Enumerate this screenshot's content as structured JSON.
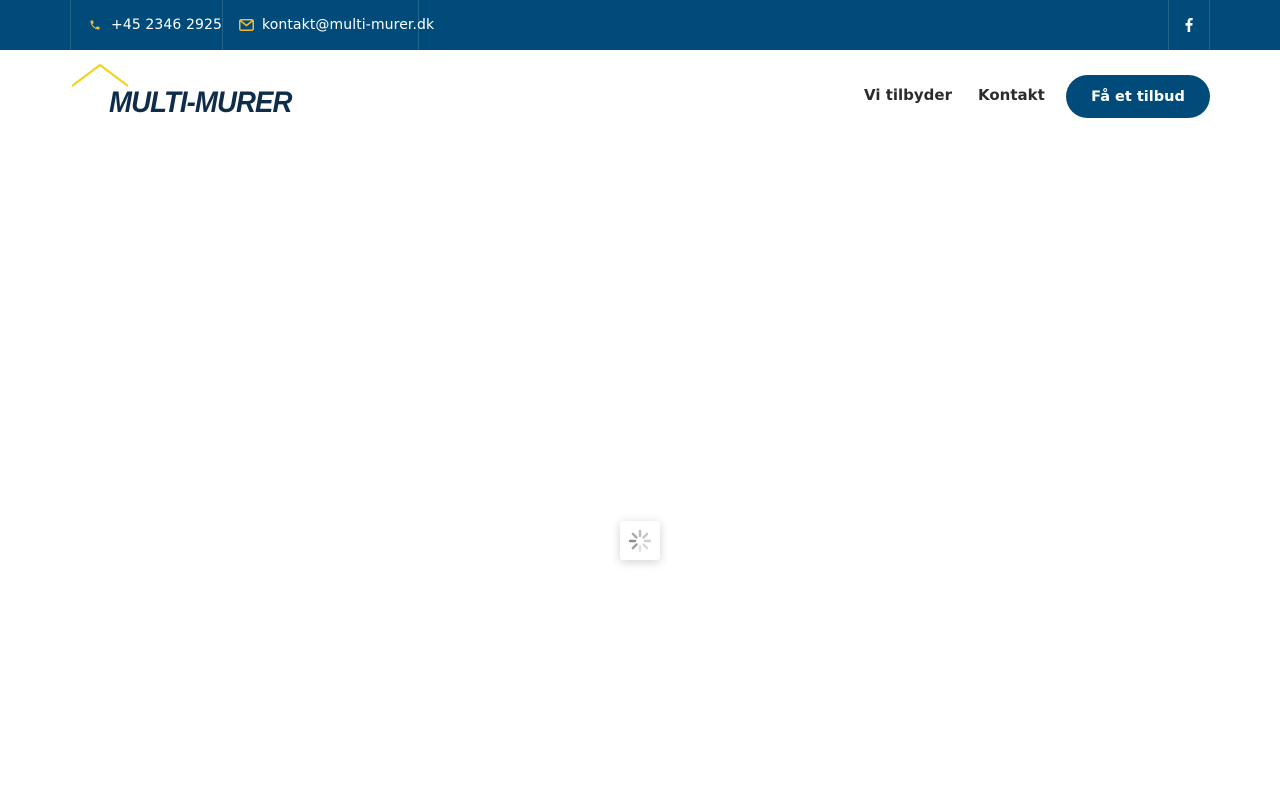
{
  "topbar": {
    "phone": "+45 2346 2925",
    "phone_icon": "phone-icon",
    "email": "kontakt@multi-murer.dk",
    "email_icon": "envelope-icon",
    "social_icon": "facebook-icon"
  },
  "header": {
    "logo_text": "MULTI-MURER",
    "nav": [
      {
        "label": "Vi tilbyder"
      },
      {
        "label": "Kontakt"
      }
    ],
    "cta_label": "Få et tilbud"
  },
  "loader": {
    "icon": "spinner-icon"
  },
  "colors": {
    "brand_blue": "#004b7a",
    "accent_yellow": "#f2c230",
    "logo_dark": "#0f2d4a"
  }
}
